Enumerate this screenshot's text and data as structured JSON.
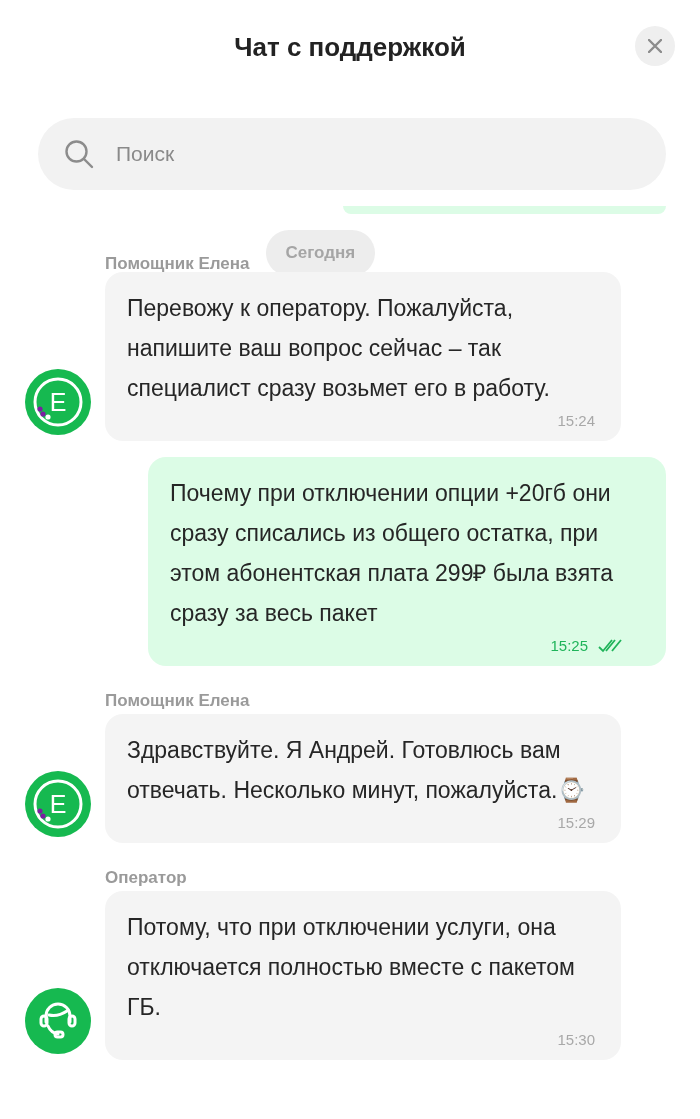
{
  "header": {
    "title": "Чат с поддержкой"
  },
  "search": {
    "placeholder": "Поиск"
  },
  "messages": [
    {
      "kind": "cut_off"
    },
    {
      "kind": "incoming",
      "sender": "Помощник Елена",
      "date_divider": "Сегодня",
      "avatar": {
        "kind": "assistant",
        "letter": "Е"
      },
      "text": "Перевожу к оператору. Пожалуйста, напишите ваш вопрос сейчас – так специалист сразу возьмет его в работу.",
      "time": "15:24"
    },
    {
      "kind": "outgoing",
      "text": "Почему при отключении опции +20гб они сразу списались из общего остатка, при этом абонентская плата 299₽ была взята сразу за весь пакет",
      "time": "15:25",
      "read": true
    },
    {
      "kind": "incoming",
      "sender": "Помощник Елена",
      "avatar": {
        "kind": "assistant",
        "letter": "Е"
      },
      "text": "Здравствуйте. Я Андрей. Готовлюсь вам отвечать. Несколько минут, пожалуйста.⌚",
      "time": "15:29"
    },
    {
      "kind": "incoming",
      "sender": "Оператор",
      "avatar": {
        "kind": "operator"
      },
      "text": "Потому, что при отключении услуги, она отключается полностью вместе с пакетом ГБ.",
      "time": "15:30"
    }
  ]
}
